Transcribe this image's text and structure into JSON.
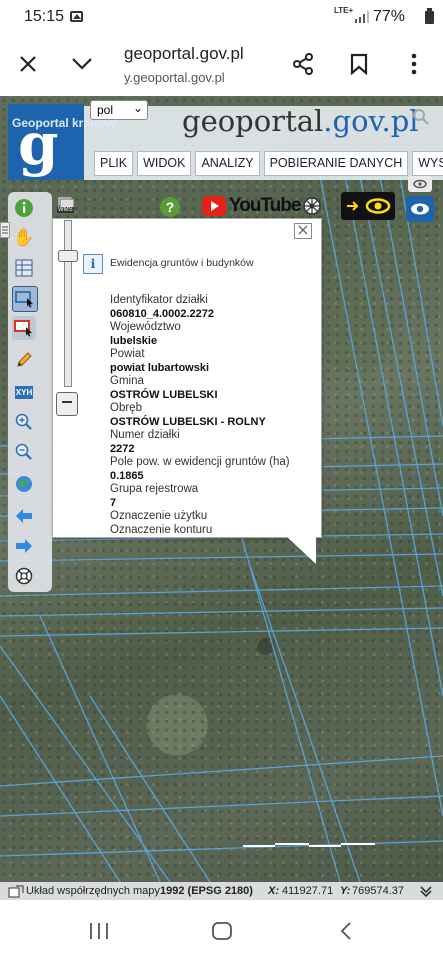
{
  "status_bar": {
    "time": "15:15",
    "network": "LTE+",
    "battery": "77%"
  },
  "browser": {
    "title": "geoportal.gov.pl",
    "url": "y.geoportal.gov.pl"
  },
  "header": {
    "crumb": "Geoportal krajowy",
    "logo_letter": "g",
    "logo_main": "geoportal",
    "logo_domain": ".gov.pl",
    "menu": [
      "PLIK",
      "WIDOK",
      "ANALIZY",
      "POBIERANIE DANYCH",
      "WYSZUK"
    ]
  },
  "toolbar": {
    "language": "pol",
    "youtube_label": "YouTube",
    "wms_label": "WMS"
  },
  "popup": {
    "title": "Ewidencja gruntów i budynków",
    "fields": [
      {
        "label": "Identyfikator działki",
        "value": "060810_4.0002.2272"
      },
      {
        "label": "Województwo",
        "value": "lubelskie"
      },
      {
        "label": "Powiat",
        "value": "powiat lubartowski"
      },
      {
        "label": "Gmina",
        "value": "OSTRÓW LUBELSKI"
      },
      {
        "label": "Obręb",
        "value": "OSTRÓW LUBELSKI - ROLNY"
      },
      {
        "label": "Numer działki",
        "value": "2272"
      },
      {
        "label": "Pole pow. w ewidencji gruntów (ha)",
        "value": "0.1865"
      },
      {
        "label": "Grupa rejestrowa",
        "value": "7"
      },
      {
        "label": "Oznaczenie użytku",
        "value": ""
      },
      {
        "label": "Oznaczenie konturu",
        "value": ""
      }
    ]
  },
  "coordinates": {
    "system_label": "Układ współrzędnych mapy",
    "system_value": "1992 (EPSG 2180)",
    "x_label": "X:",
    "x_value": "411927.71",
    "y_label": "Y:",
    "y_value": "769574.37"
  },
  "colors": {
    "accent": "#1e63ad",
    "parcel_lines": "#5aa9e6"
  }
}
